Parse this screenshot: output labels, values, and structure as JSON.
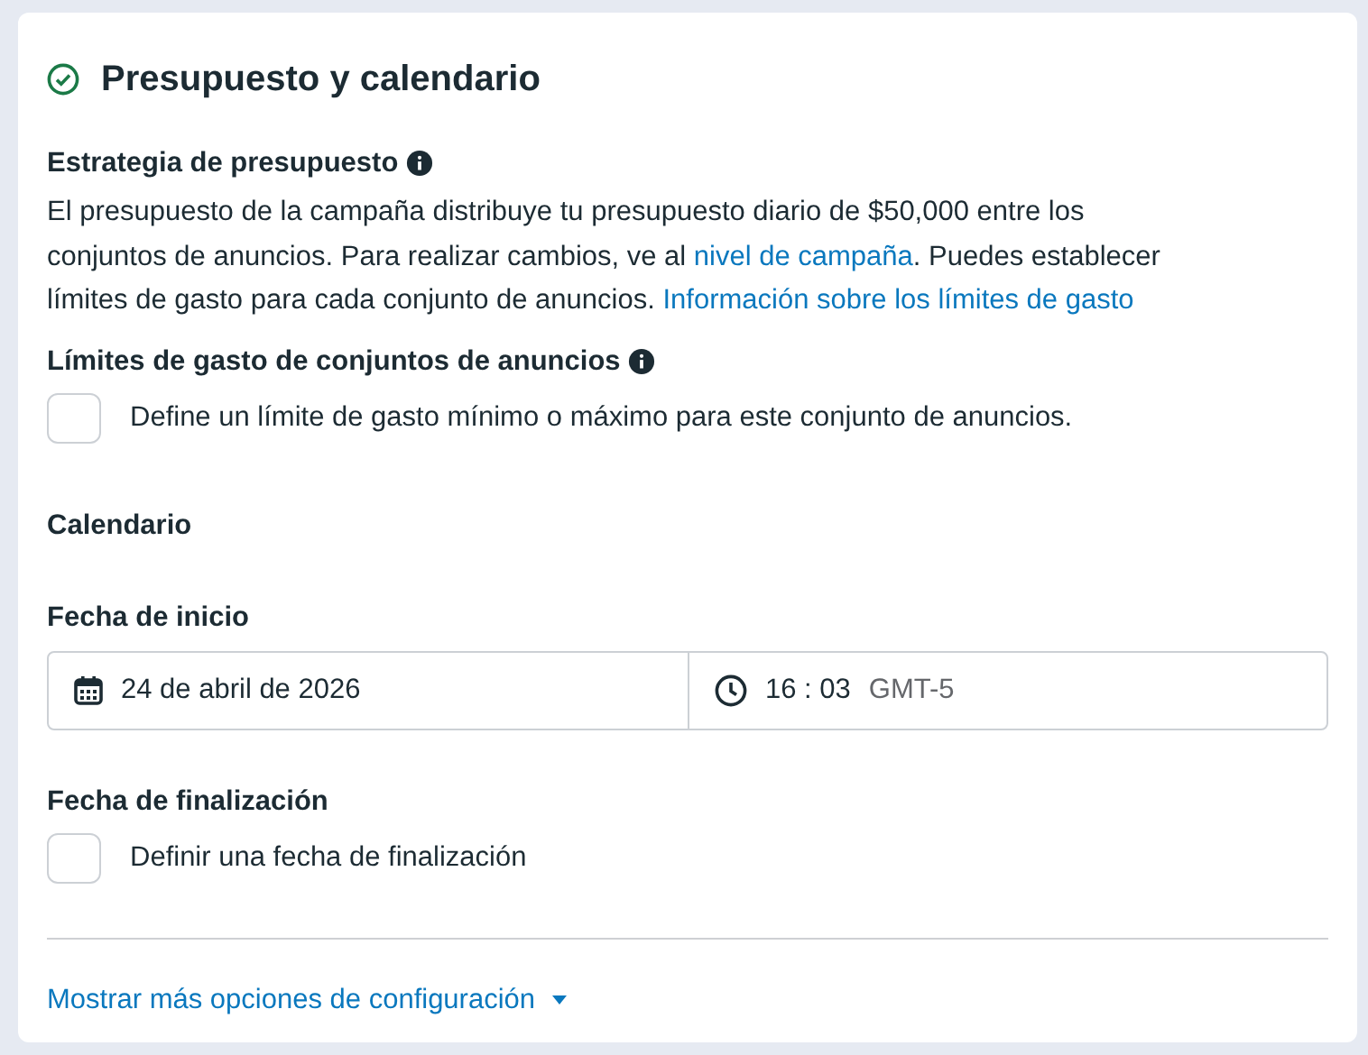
{
  "section": {
    "title": "Presupuesto y calendario",
    "completed": true
  },
  "budget_strategy": {
    "heading": "Estrategia de presupuesto",
    "description": [
      {
        "kind": "text",
        "text": "El presupuesto de la campaña distribuye tu presupuesto diario de $50,000 entre los conjuntos de anuncios. Para realizar cambios, ve al "
      },
      {
        "kind": "link",
        "text": "nivel de campaña"
      },
      {
        "kind": "text",
        "text": ". Puedes establecer límites de gasto para cada conjunto de anuncios. "
      },
      {
        "kind": "link",
        "text": "Información sobre los límites de gasto"
      }
    ]
  },
  "spend_limits": {
    "heading": "Límites de gasto de conjuntos de anuncios",
    "checkbox": {
      "label": "Define un límite de gasto mínimo o máximo para este conjunto de anuncios.",
      "checked": false
    }
  },
  "calendar": {
    "heading": "Calendario",
    "start": {
      "label": "Fecha de inicio",
      "date": "24 de abril de 2026",
      "hour": "16",
      "separator": ":",
      "minute": "03",
      "timezone": "GMT-5"
    },
    "end": {
      "label": "Fecha de finalización",
      "checkbox": {
        "label": "Definir una fecha de finalización",
        "checked": false
      }
    }
  },
  "more_options": {
    "label": "Mostrar más opciones de configuración",
    "expanded": false
  }
}
